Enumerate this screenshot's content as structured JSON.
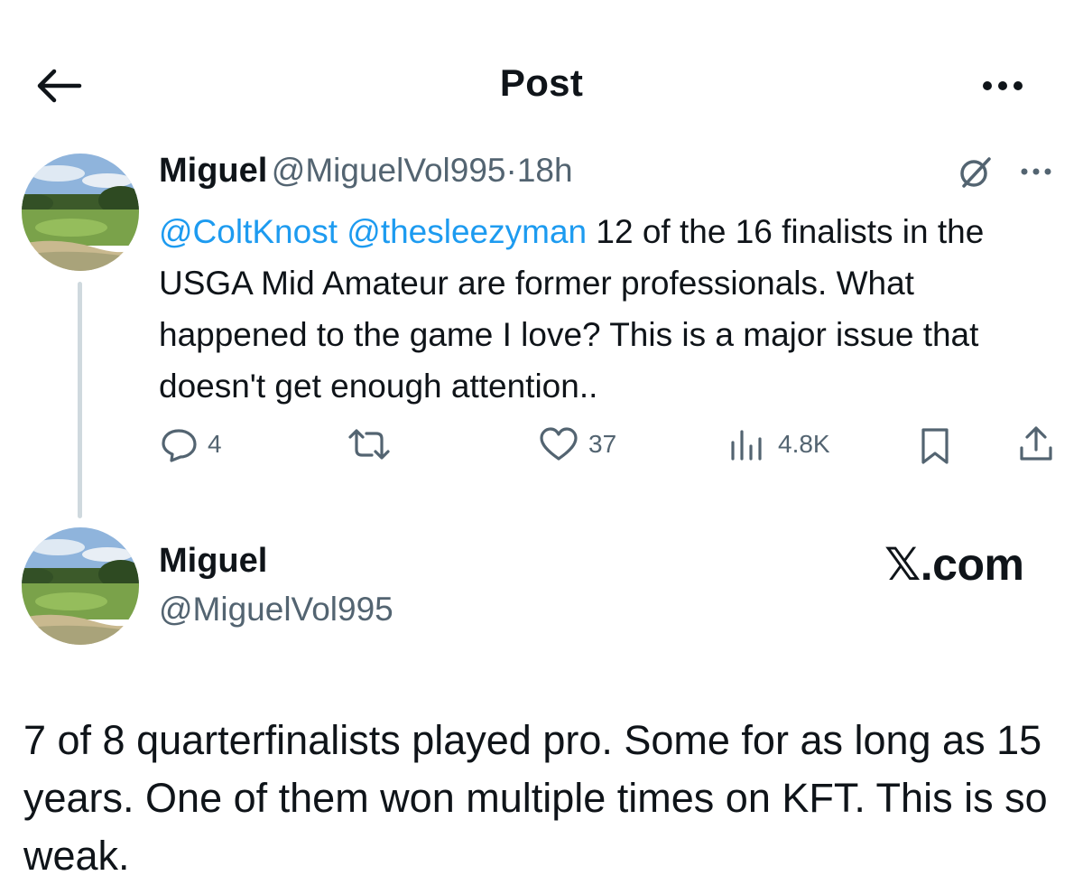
{
  "header": {
    "title": "Post",
    "back_icon": "arrow-left-icon",
    "more_icon": "more-horizontal-icon"
  },
  "reply_tweet": {
    "author_name": "Miguel",
    "author_handle": "@MiguelVol995",
    "separator": "·",
    "timestamp": "18h",
    "mentions": [
      "@ColtKnost",
      "@thesleezyman"
    ],
    "text": "12 of the 16 finalists in the USGA Mid Amateur are former professionals. What happened to the game I love? This is a major issue that doesn't get enough attention..",
    "actions": {
      "replies": "4",
      "retweets": "",
      "likes": "37",
      "views": "4.8K"
    }
  },
  "main_tweet": {
    "author_name": "Miguel",
    "author_handle": "@MiguelVol995",
    "watermark": "𝕏.com",
    "text": "7 of 8 quarterfinalists played pro. Some for as long as 15 years. One of them won multiple times on KFT. This is so weak."
  },
  "colors": {
    "text": "#0f1419",
    "secondary": "#536471",
    "link": "#1d9bf0",
    "thread_line": "#cfd9de"
  }
}
